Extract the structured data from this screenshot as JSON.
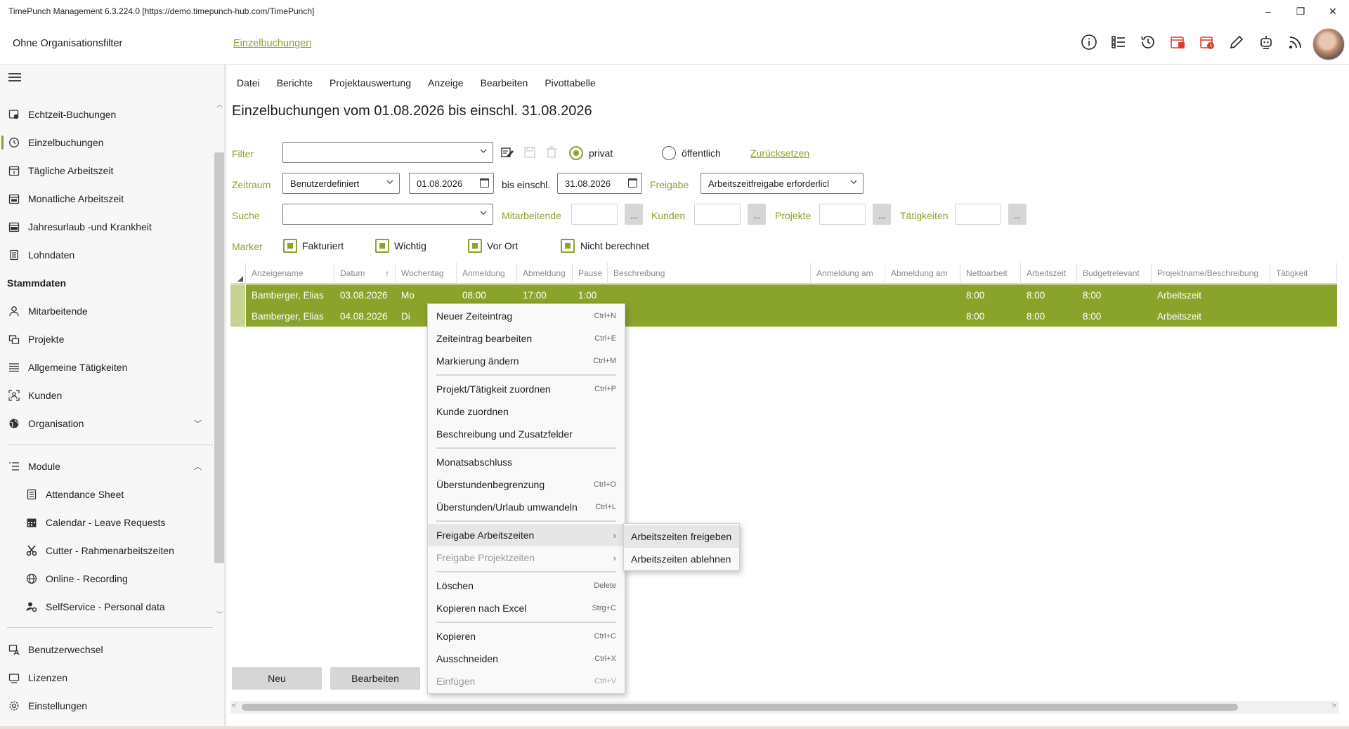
{
  "window": {
    "title": "TimePunch Management 6.3.224.0 [https://demo.timepunch-hub.com/TimePunch]",
    "controls": [
      "–",
      "❐",
      "✕"
    ]
  },
  "header": {
    "org_filter": "Ohne Organisationsfilter",
    "page_link": "Einzelbuchungen"
  },
  "sidebar": {
    "items": [
      {
        "label": "Echtzeit-Buchungen",
        "icon": "realtime-icon"
      },
      {
        "label": "Einzelbuchungen",
        "icon": "clock-icon"
      },
      {
        "label": "Tägliche Arbeitszeit",
        "icon": "calendar-day-icon"
      },
      {
        "label": "Monatliche Arbeitszeit",
        "icon": "calendar-month-icon"
      },
      {
        "label": "Jahresurlaub -und Krankheit",
        "icon": "calendar-year-icon"
      },
      {
        "label": "Lohndaten",
        "icon": "document-icon"
      }
    ],
    "stammdaten_label": "Stammdaten",
    "stammdaten": [
      {
        "label": "Mitarbeitende",
        "icon": "person-icon"
      },
      {
        "label": "Projekte",
        "icon": "projects-icon"
      },
      {
        "label": "Allgemeine Tätigkeiten",
        "icon": "list-icon"
      },
      {
        "label": "Kunden",
        "icon": "customer-icon"
      },
      {
        "label": "Organisation",
        "icon": "globe-icon"
      }
    ],
    "module_label": "Module",
    "modules": [
      {
        "label": "Attendance Sheet",
        "icon": "sheet-icon"
      },
      {
        "label": "Calendar - Leave Requests",
        "icon": "calendar-icon"
      },
      {
        "label": "Cutter - Rahmenarbeitszeiten",
        "icon": "scissors-icon"
      },
      {
        "label": "Online - Recording",
        "icon": "globe-icon"
      },
      {
        "label": "SelfService - Personal data",
        "icon": "person-settings-icon"
      }
    ],
    "bottom": [
      {
        "label": "Benutzerwechsel",
        "icon": "switch-user-icon"
      },
      {
        "label": "Lizenzen",
        "icon": "license-icon"
      },
      {
        "label": "Einstellungen",
        "icon": "gear-icon"
      }
    ]
  },
  "menubar": [
    "Datei",
    "Berichte",
    "Projektauswertung",
    "Anzeige",
    "Bearbeiten",
    "Pivottabelle"
  ],
  "heading": "Einzelbuchungen vom 01.08.2026 bis einschl. 31.08.2026",
  "filter": {
    "label": "Filter",
    "value": "",
    "radio_private": "privat",
    "radio_public": "öffentlich",
    "reset": "Zurücksetzen"
  },
  "zeitraum": {
    "label": "Zeitraum",
    "mode": "Benutzerdefiniert",
    "from": "01.08.2026",
    "to_label": "bis einschl.",
    "to": "31.08.2026",
    "freigabe_label": "Freigabe",
    "freigabe_value": "Arbeitszeitfreigabe erforderlicl"
  },
  "suche": {
    "label": "Suche",
    "value": "",
    "mitarbeitende": "Mitarbeitende",
    "kunden": "Kunden",
    "projekte": "Projekte",
    "taetigkeiten": "Tätigkeiten",
    "dots": "..."
  },
  "marker": {
    "label": "Marker",
    "items": [
      "Fakturiert",
      "Wichtig",
      "Vor Ort",
      "Nicht berechnet"
    ]
  },
  "grid": {
    "columns": [
      "Anzeigename",
      "Datum",
      "Wochentag",
      "Anmeldung",
      "Abmeldung",
      "Pause",
      "Beschreibung",
      "Anmeldung am",
      "Abmeldung am",
      "Nettoarbeit",
      "Arbeitszeit",
      "Budgetrelevant",
      "Projektname/Beschreibung",
      "Tätigkeit"
    ],
    "rows": [
      {
        "name": "Bamberger, Elias",
        "datum": "03.08.2026",
        "wochentag": "Mo",
        "anmeldung": "08:00",
        "abmeldung": "17:00",
        "pause": "1:00",
        "netto": "8:00",
        "arbeitszeit": "8:00",
        "budget": "8:00",
        "projekt": "Arbeitszeit"
      },
      {
        "name": "Bamberger, Elias",
        "datum": "04.08.2026",
        "wochentag": "Di",
        "anmeldung": "",
        "abmeldung": "",
        "pause": "",
        "netto": "8:00",
        "arbeitszeit": "8:00",
        "budget": "8:00",
        "projekt": "Arbeitszeit"
      }
    ]
  },
  "buttons": {
    "neu": "Neu",
    "bearbeiten": "Bearbeiten"
  },
  "context_menu": {
    "items": [
      {
        "label": "Neuer Zeiteintrag",
        "key": "Ctrl+N"
      },
      {
        "label": "Zeiteintrag bearbeiten",
        "key": "Ctrl+E"
      },
      {
        "label": "Markierung ändern",
        "key": "Ctrl+M"
      },
      {
        "label": "Projekt/Tätigkeit zuordnen",
        "key": "Ctrl+P"
      },
      {
        "label": "Kunde zuordnen",
        "key": ""
      },
      {
        "label": "Beschreibung und Zusatzfelder",
        "key": ""
      },
      {
        "label": "Monatsabschluss",
        "key": ""
      },
      {
        "label": "Überstundenbegrenzung",
        "key": "Ctrl+O"
      },
      {
        "label": "Überstunden/Urlaub umwandeln",
        "key": "Ctrl+L"
      },
      {
        "label": "Freigabe Arbeitszeiten",
        "key": ""
      },
      {
        "label": "Freigabe Projektzeiten",
        "key": ""
      },
      {
        "label": "Löschen",
        "key": "Delete"
      },
      {
        "label": "Kopieren nach Excel",
        "key": "Strg+C"
      },
      {
        "label": "Kopieren",
        "key": "Ctrl+C"
      },
      {
        "label": "Ausschneiden",
        "key": "Ctrl+X"
      },
      {
        "label": "Einfügen",
        "key": "Ctrl+V"
      }
    ],
    "submenu": [
      "Arbeitszeiten freigeben",
      "Arbeitszeiten ablehnen"
    ]
  },
  "colors": {
    "accent": "#8aa32b",
    "row_selected": "#8aa32b",
    "icon_red": "#e03a2e"
  }
}
